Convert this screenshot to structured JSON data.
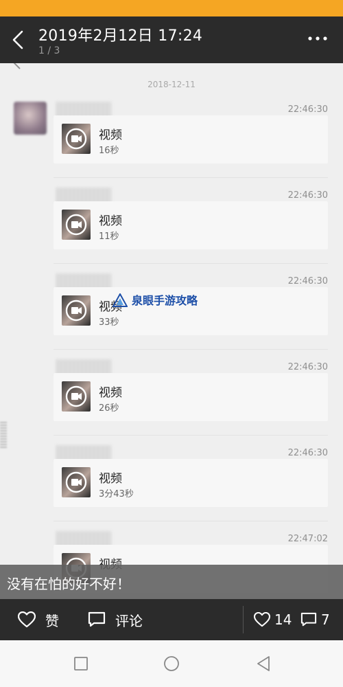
{
  "header": {
    "title": "2019年2月12日 17:24",
    "counter": "1 / 3",
    "background": "#2b2b2b",
    "accent": "#f5a623"
  },
  "screenshot": {
    "date_separator": "2018-12-11",
    "messages": [
      {
        "time": "22:46:30",
        "label": "视频",
        "duration": "16秒"
      },
      {
        "time": "22:46:30",
        "label": "视频",
        "duration": "11秒"
      },
      {
        "time": "22:46:30",
        "label": "视频",
        "duration": "33秒"
      },
      {
        "time": "22:46:30",
        "label": "视频",
        "duration": "26秒"
      },
      {
        "time": "22:46:30",
        "label": "视频",
        "duration": "3分43秒"
      },
      {
        "time": "22:47:02",
        "label": "视频",
        "duration": ""
      }
    ]
  },
  "watermark": {
    "text": "泉眼手游攻略",
    "color": "#1d4fa8"
  },
  "caption": "没有在怕的好不好！",
  "actions": {
    "like_label": "赞",
    "comment_label": "评论",
    "like_count": "14",
    "comment_count": "7"
  },
  "icons": [
    "back-icon",
    "more-icon",
    "video-play-icon",
    "heart-icon",
    "comment-icon",
    "recent-apps-icon",
    "home-icon",
    "back-nav-icon"
  ]
}
